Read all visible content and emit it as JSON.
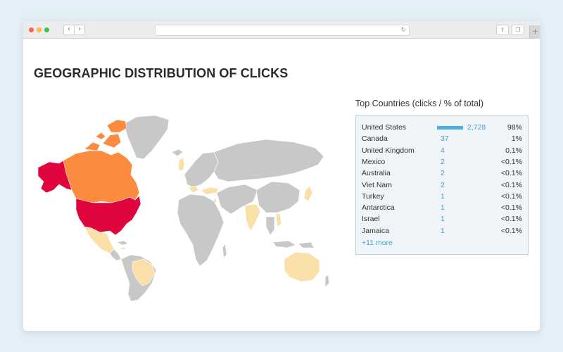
{
  "browser": {
    "back_icon": "‹",
    "forward_icon": "›",
    "reload_icon": "↻",
    "share_icon": "⇪",
    "tabs_icon": "❐",
    "new_tab_icon": "+"
  },
  "page": {
    "title": "GEOGRAPHIC DISTRIBUTION OF CLICKS"
  },
  "colors": {
    "high": "#e0053d",
    "mid": "#fb8b3f",
    "low": "#fadfa8",
    "none": "#c8c8c8",
    "bar": "#4eaedc",
    "link": "#4a9fd0"
  },
  "top_countries": {
    "title": "Top Countries (clicks / % of total)",
    "rows": [
      {
        "country": "United States",
        "clicks": "2,728",
        "pct": "98%",
        "share": 0.98
      },
      {
        "country": "Canada",
        "clicks": "37",
        "pct": "1%",
        "share": 0.01
      },
      {
        "country": "United Kingdom",
        "clicks": "4",
        "pct": "0.1%",
        "share": 0.001
      },
      {
        "country": "Mexico",
        "clicks": "2",
        "pct": "<0.1%",
        "share": 0
      },
      {
        "country": "Australia",
        "clicks": "2",
        "pct": "<0.1%",
        "share": 0
      },
      {
        "country": "Viet Nam",
        "clicks": "2",
        "pct": "<0.1%",
        "share": 0
      },
      {
        "country": "Turkey",
        "clicks": "1",
        "pct": "<0.1%",
        "share": 0
      },
      {
        "country": "Antarctica",
        "clicks": "1",
        "pct": "<0.1%",
        "share": 0
      },
      {
        "country": "Israel",
        "clicks": "1",
        "pct": "<0.1%",
        "share": 0
      },
      {
        "country": "Jamaica",
        "clicks": "1",
        "pct": "<0.1%",
        "share": 0
      }
    ],
    "more_link": "+11 more"
  }
}
